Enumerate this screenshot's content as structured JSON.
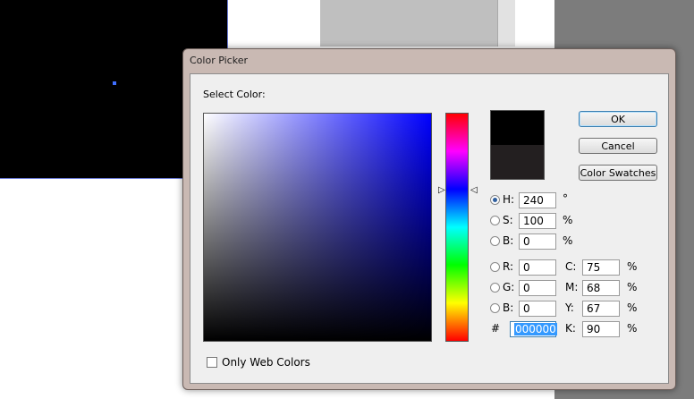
{
  "dialog": {
    "title": "Color Picker"
  },
  "picker": {
    "select_label": "Select Color:"
  },
  "buttons": {
    "ok": "OK",
    "cancel": "Cancel",
    "swatches": "Color Swatches"
  },
  "hsb": [
    {
      "label": "H:",
      "value": "240",
      "unit": "°",
      "selected": true
    },
    {
      "label": "S:",
      "value": "100",
      "unit": "%",
      "selected": false
    },
    {
      "label": "B:",
      "value": "0",
      "unit": "%",
      "selected": false
    }
  ],
  "rgb": [
    {
      "label": "R:",
      "value": "0"
    },
    {
      "label": "G:",
      "value": "0"
    },
    {
      "label": "B:",
      "value": "0"
    }
  ],
  "hex": {
    "symbol": "#",
    "value": "000000"
  },
  "cmyk": [
    {
      "label": "C:",
      "value": "75",
      "unit": "%"
    },
    {
      "label": "M:",
      "value": "68",
      "unit": "%"
    },
    {
      "label": "Y:",
      "value": "67",
      "unit": "%"
    },
    {
      "label": "K:",
      "value": "90",
      "unit": "%"
    }
  ],
  "web_colors": {
    "label": "Only Web Colors",
    "checked": false
  },
  "swatch": {
    "new_color": "#000000",
    "old_color": "#231f20"
  },
  "hue_arrows": {
    "left": "▷",
    "right": "◁"
  }
}
